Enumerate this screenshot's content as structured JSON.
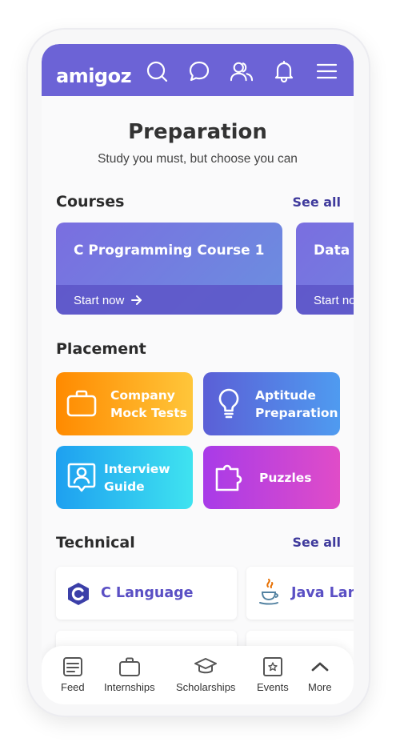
{
  "app": {
    "logo": "amigoz"
  },
  "header_icons": [
    "search-icon",
    "chat-icon",
    "users-icon",
    "bell-icon",
    "menu-icon"
  ],
  "page": {
    "title": "Preparation",
    "subtitle": "Study you must, but choose you can"
  },
  "courses": {
    "title": "Courses",
    "see_all": "See all",
    "items": [
      {
        "title": "C Programming Course 1",
        "cta": "Start now"
      },
      {
        "title": "Data S",
        "cta": "Start no"
      }
    ]
  },
  "placement": {
    "title": "Placement",
    "tiles": [
      {
        "line1": "Company",
        "line2": "Mock Tests",
        "icon": "briefcase-icon",
        "colors": [
          "#ff8a00",
          "#ffc63a"
        ]
      },
      {
        "line1": "Aptitude",
        "line2": "Preparation",
        "icon": "lightbulb-icon",
        "colors": [
          "#5b5fd6",
          "#4f9bf0"
        ]
      },
      {
        "line1": "Interview",
        "line2": "Guide",
        "icon": "interview-icon",
        "colors": [
          "#1ea0f0",
          "#3fe3f0"
        ]
      },
      {
        "line1": "Puzzles",
        "line2": "",
        "icon": "puzzle-icon",
        "colors": [
          "#a83be8",
          "#e04cc8"
        ]
      }
    ]
  },
  "technical": {
    "title": "Technical",
    "see_all": "See all",
    "items": [
      {
        "label": "C Language",
        "icon": "c-language-icon"
      },
      {
        "label": "Java Lang",
        "icon": "java-icon"
      }
    ]
  },
  "bottom_nav": [
    {
      "label": "Feed",
      "icon": "feed-icon"
    },
    {
      "label": "Internships",
      "icon": "briefcase-icon"
    },
    {
      "label": "Scholarships",
      "icon": "graduation-cap-icon"
    },
    {
      "label": "Events",
      "icon": "events-icon"
    },
    {
      "label": "More",
      "icon": "chevron-up-icon"
    }
  ],
  "colors": {
    "primary": "#6c63d6",
    "link": "#3f3a9c"
  }
}
